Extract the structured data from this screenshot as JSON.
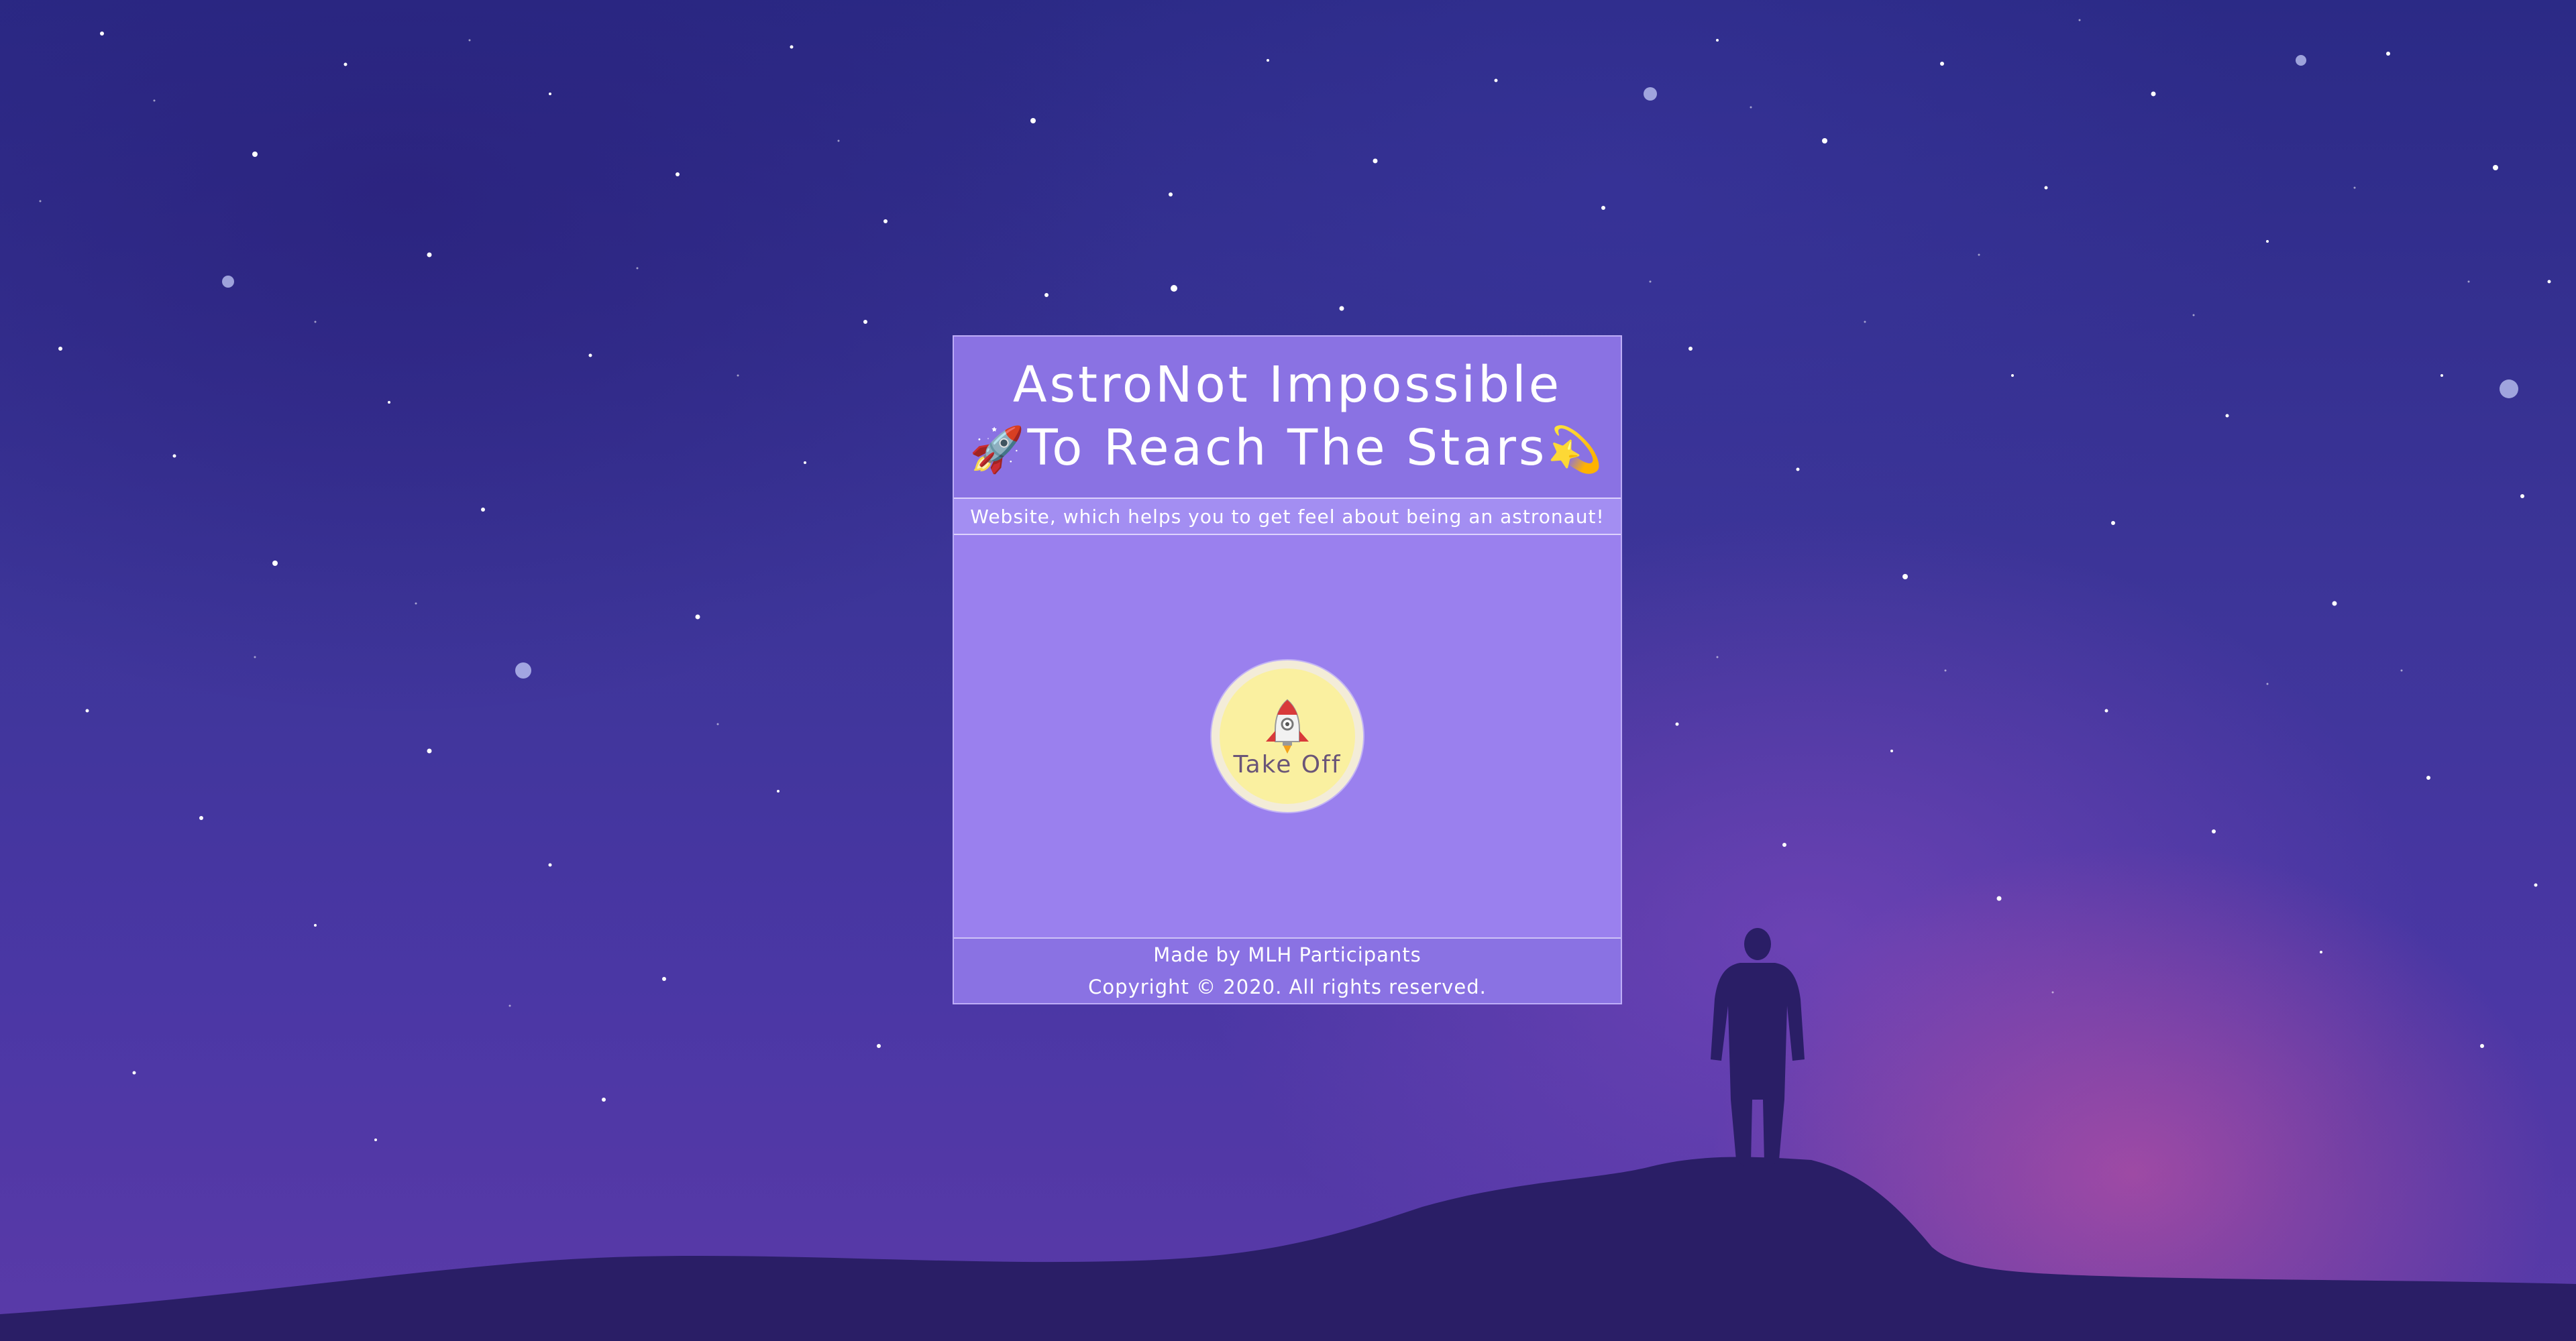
{
  "header": {
    "title_line1": "AstroNot Impossible",
    "title_line2": "To Reach The Stars",
    "emoji_left": "🚀",
    "emoji_right": "💫"
  },
  "tagline": "Website, which helps you to get feel about being an astronaut!",
  "main": {
    "button_label": "Take Off",
    "button_icon": "rocket-icon"
  },
  "footer": {
    "made_by": "Made by MLH Participants",
    "copyright": "Copyright © 2020. All rights reserved."
  },
  "colors": {
    "header_bg": "#8a72e3",
    "main_bg": "#9a80ee",
    "button_bg": "#faf0a0",
    "sky_top": "#2b2a86",
    "sky_bottom": "#5a3aa8"
  }
}
